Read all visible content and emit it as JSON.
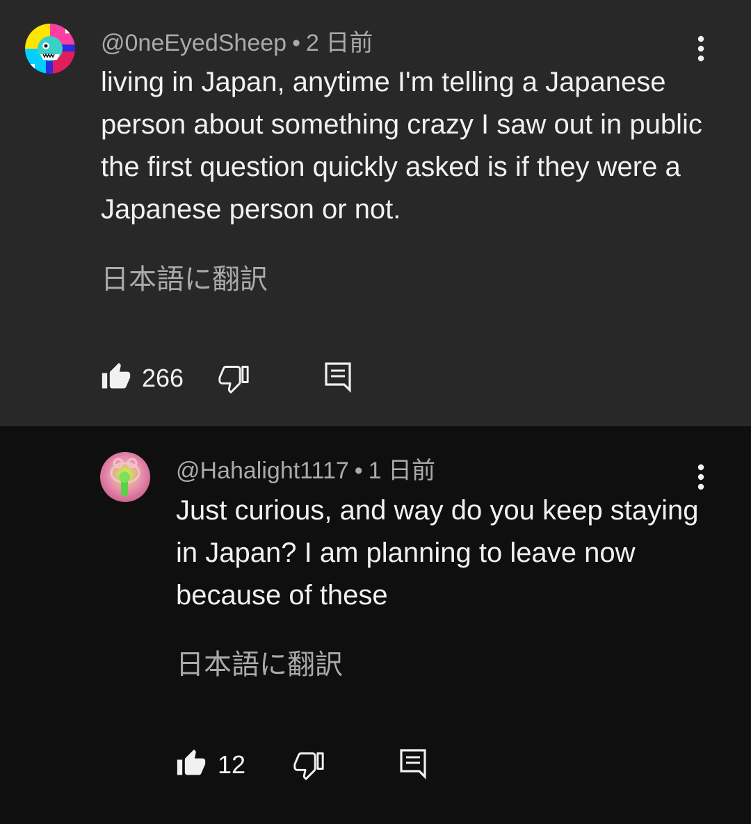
{
  "comments": [
    {
      "handle": "@0neEyedSheep",
      "separator": "•",
      "time": "2 日前",
      "text": "living in Japan, anytime I'm telling a Japanese person about something crazy I saw out in public the first question quickly asked is if they were a Japanese person or not.",
      "translate_label": "日本語に翻訳",
      "likes": "266",
      "icons": {
        "avatar": "avatar-image",
        "like": "thumbs-up-icon",
        "dislike": "thumbs-down-icon",
        "reply": "reply-comment-icon",
        "more": "more-vert-icon"
      }
    },
    {
      "handle": "@Hahalight1117",
      "separator": "•",
      "time": "1 日前",
      "text": "Just curious, and way do you keep staying in Japan? I am planning to leave now because of these",
      "translate_label": "日本語に翻訳",
      "likes": "12",
      "icons": {
        "avatar": "avatar-image",
        "like": "thumbs-up-icon",
        "dislike": "thumbs-down-icon",
        "reply": "reply-comment-icon",
        "more": "more-vert-icon"
      }
    }
  ],
  "colors": {
    "parent_bg": "#282828",
    "reply_bg": "#0f0f0f",
    "primary_text": "#f1f1f1",
    "secondary_text": "#aaaaaa"
  }
}
